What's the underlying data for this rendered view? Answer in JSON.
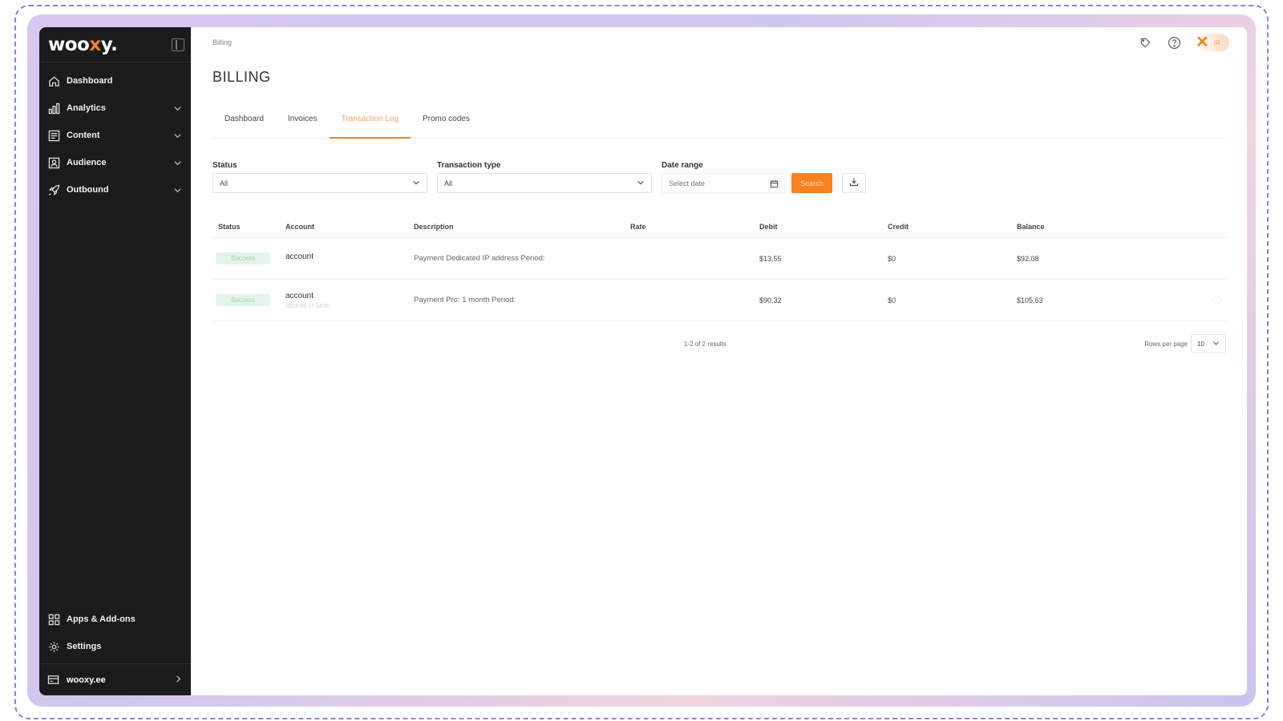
{
  "brand": {
    "logo_pre": "woo",
    "logo_x": "x",
    "logo_post": "y.",
    "accent": "#f5821f"
  },
  "sidebar": {
    "items": [
      {
        "label": "Dashboard",
        "icon": "home-icon",
        "expandable": false
      },
      {
        "label": "Analytics",
        "icon": "bar-chart-icon",
        "expandable": true
      },
      {
        "label": "Content",
        "icon": "content-icon",
        "expandable": true
      },
      {
        "label": "Audience",
        "icon": "user-icon",
        "expandable": true
      },
      {
        "label": "Outbound",
        "icon": "rocket-icon",
        "expandable": true
      }
    ],
    "bottom": [
      {
        "label": "Apps & Add-ons",
        "icon": "grid-icon"
      },
      {
        "label": "Settings",
        "icon": "gear-icon"
      }
    ],
    "footer": {
      "label": "wooxy.ee",
      "icon": "card-icon"
    }
  },
  "header": {
    "breadcrumb": "Billing",
    "avatar_initials": "IR"
  },
  "page": {
    "title": "BILLING"
  },
  "tabs": [
    {
      "label": "Dashboard",
      "active": false
    },
    {
      "label": "Invoices",
      "active": false
    },
    {
      "label": "Transaction Log",
      "active": true
    },
    {
      "label": "Promo codes",
      "active": false
    }
  ],
  "filters": {
    "status": {
      "label": "Status",
      "value": "All"
    },
    "type": {
      "label": "Transaction type",
      "value": "All"
    },
    "date": {
      "label": "Date range",
      "placeholder": "Select date"
    },
    "search_label": "Search"
  },
  "table": {
    "columns": [
      "Status",
      "Account",
      "Description",
      "Rate",
      "Debit",
      "Credit",
      "Balance"
    ],
    "rows": [
      {
        "status": "Success",
        "account": "account",
        "account_sub": "",
        "description": "Payment Dedicated IP address Period:",
        "rate": "",
        "debit": "$13,55",
        "credit": "$0",
        "balance": "$92,08"
      },
      {
        "status": "Success",
        "account": "account",
        "account_sub": "2023-03-17 14:00",
        "description": "Payment Pro: 1 month Period:",
        "rate": "",
        "debit": "$90,32",
        "credit": "$0",
        "balance": "$105,63"
      }
    ]
  },
  "pagination": {
    "results": "1-2 of 2 results",
    "rows_label": "Rows per page",
    "rows_value": "10"
  }
}
